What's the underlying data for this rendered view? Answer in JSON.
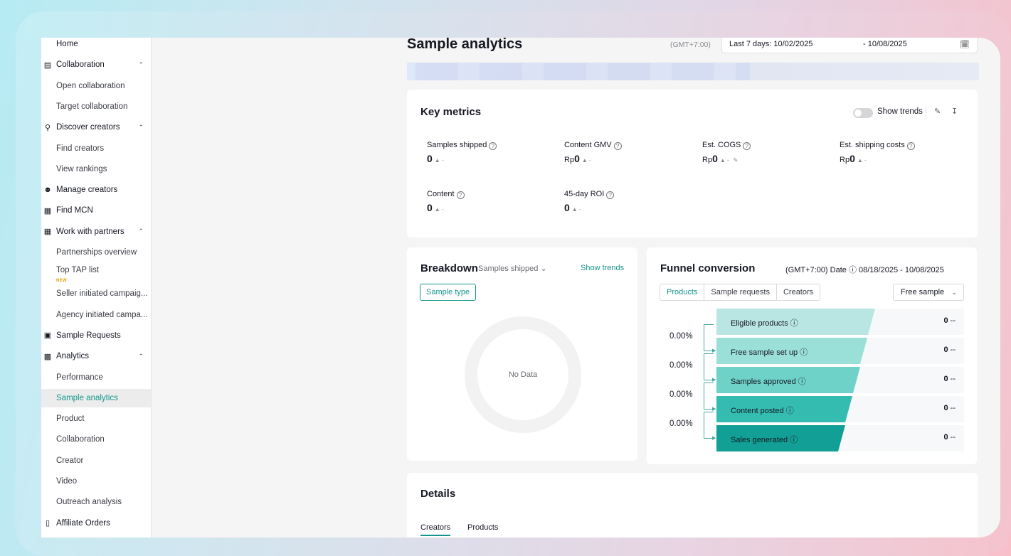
{
  "sidebar": {
    "items": [
      {
        "label": "Home",
        "icon": "home-icon",
        "level": 0
      },
      {
        "label": "Collaboration",
        "icon": "clipboard-icon",
        "level": 0,
        "expanded": true
      },
      {
        "label": "Open collaboration",
        "level": 1
      },
      {
        "label": "Target collaboration",
        "level": 1
      },
      {
        "label": "Discover creators",
        "icon": "person-search-icon",
        "level": 0,
        "expanded": true
      },
      {
        "label": "Find creators",
        "level": 1
      },
      {
        "label": "View rankings",
        "level": 1
      },
      {
        "label": "Manage creators",
        "icon": "people-icon",
        "level": 0
      },
      {
        "label": "Find MCN",
        "icon": "building-icon",
        "level": 0
      },
      {
        "label": "Work with partners",
        "icon": "partners-icon",
        "level": 0,
        "expanded": true
      },
      {
        "label": "Partnerships overview",
        "level": 1
      },
      {
        "label": "Top TAP list",
        "level": 1,
        "badge": "NEW"
      },
      {
        "label": "Seller initiated campaig...",
        "level": 1
      },
      {
        "label": "Agency initiated campa...",
        "level": 1
      },
      {
        "label": "Sample Requests",
        "icon": "gift-icon",
        "level": 0
      },
      {
        "label": "Analytics",
        "icon": "chart-icon",
        "level": 0,
        "expanded": true
      },
      {
        "label": "Performance",
        "level": 1
      },
      {
        "label": "Sample analytics",
        "level": 1,
        "active": true
      },
      {
        "label": "Product",
        "level": 1
      },
      {
        "label": "Collaboration",
        "level": 1
      },
      {
        "label": "Creator",
        "level": 1
      },
      {
        "label": "Video",
        "level": 1
      },
      {
        "label": "Outreach analysis",
        "level": 1
      },
      {
        "label": "Affiliate Orders",
        "icon": "receipt-icon",
        "level": 0
      }
    ]
  },
  "header": {
    "title": "Sample analytics",
    "timezone": "(GMT+7:00)",
    "date_start": "Last 7 days: 10/02/2025",
    "date_end": "-  10/08/2025"
  },
  "key_metrics": {
    "title": "Key metrics",
    "show_trends": "Show trends",
    "metrics": [
      {
        "label": "Samples shipped",
        "currency": "",
        "value": "0",
        "trend": "▲ -"
      },
      {
        "label": "Content GMV",
        "currency": "Rp",
        "value": "0",
        "trend": "▲ -"
      },
      {
        "label": "Est. COGS",
        "currency": "Rp",
        "value": "0",
        "trend": "▲ -"
      },
      {
        "label": "Est. shipping costs",
        "currency": "Rp",
        "value": "0",
        "trend": "▲ -"
      },
      {
        "label": "Content",
        "currency": "",
        "value": "0",
        "trend": "▲ -"
      },
      {
        "label": "45-day ROI",
        "currency": "",
        "value": "0",
        "trend": "▲ -"
      }
    ]
  },
  "breakdown": {
    "title": "Breakdown",
    "metric_select": "Samples shipped",
    "show_trends": "Show trends",
    "chip": "Sample type",
    "empty": "No Data"
  },
  "funnel": {
    "title": "Funnel conversion",
    "meta": "(GMT+7:00)  Date",
    "date_range": "08/18/2025 - 10/08/2025",
    "tabs": [
      "Products",
      "Sample requests",
      "Creators"
    ],
    "select": "Free sample",
    "stages": [
      {
        "label": "Eligible products",
        "value": "0",
        "delta": "--",
        "color": "#b9e6e3",
        "share": 0.64
      },
      {
        "label": "Free sample set up",
        "value": "0",
        "delta": "--",
        "color": "#9be0d8",
        "share": 0.61
      },
      {
        "label": "Samples approved",
        "value": "0",
        "delta": "--",
        "color": "#6fd2c9",
        "share": 0.58
      },
      {
        "label": "Content posted",
        "value": "0",
        "delta": "--",
        "color": "#35bcb1",
        "share": 0.55
      },
      {
        "label": "Sales generated",
        "value": "0",
        "delta": "--",
        "color": "#129f95",
        "share": 0.52
      }
    ],
    "conversions": [
      "0.00%",
      "0.00%",
      "0.00%",
      "0.00%"
    ]
  },
  "details": {
    "title": "Details",
    "tabs": [
      "Creators",
      "Products"
    ]
  }
}
